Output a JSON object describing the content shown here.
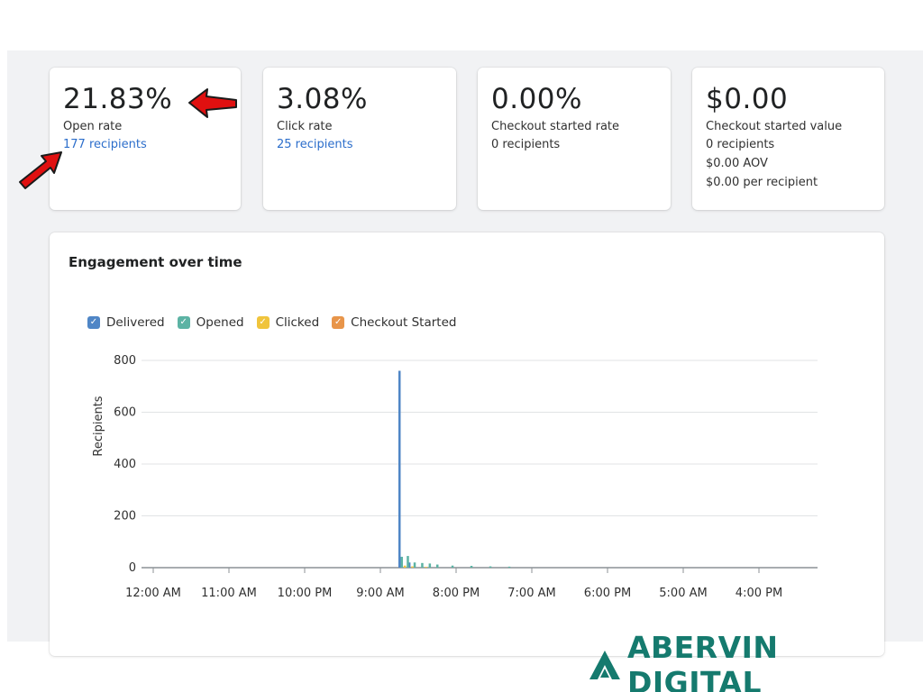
{
  "metrics": [
    {
      "value": "21.83%",
      "label": "Open rate",
      "lines": [
        "177 recipients"
      ]
    },
    {
      "value": "3.08%",
      "label": "Click rate",
      "lines": [
        "25 recipients"
      ]
    },
    {
      "value": "0.00%",
      "label": "Checkout started rate",
      "lines": [
        "0 recipients"
      ]
    },
    {
      "value": "$0.00",
      "label": "Checkout started value",
      "lines": [
        "0 recipients",
        "$0.00 AOV",
        "$0.00 per recipient"
      ]
    }
  ],
  "engagement": {
    "title": "Engagement over time",
    "legend": [
      {
        "name": "Delivered",
        "color": "#4f86c6",
        "checked": true
      },
      {
        "name": "Opened",
        "color": "#5cb3a4",
        "checked": true
      },
      {
        "name": "Clicked",
        "color": "#f0c43c",
        "checked": true
      },
      {
        "name": "Checkout Started",
        "color": "#e8954a",
        "checked": true
      }
    ]
  },
  "chart_data": {
    "type": "bar",
    "ylabel": "Recipients",
    "ylim": [
      0,
      800
    ],
    "yticks": [
      0,
      200,
      400,
      600,
      800
    ],
    "xticks": [
      "12:00 AM",
      "11:00 AM",
      "10:00 PM",
      "9:00 AM",
      "8:00 PM",
      "7:00 AM",
      "6:00 PM",
      "5:00 AM",
      "4:00 PM"
    ],
    "grid": true,
    "series": [
      {
        "name": "Delivered",
        "color": "#4f86c6",
        "points": [
          {
            "x": 3.25,
            "y": 760
          },
          {
            "x": 3.38,
            "y": 20
          }
        ]
      },
      {
        "name": "Opened",
        "color": "#5cb3a4",
        "points": [
          {
            "x": 3.28,
            "y": 42
          },
          {
            "x": 3.36,
            "y": 45
          },
          {
            "x": 3.45,
            "y": 20
          },
          {
            "x": 3.55,
            "y": 18
          },
          {
            "x": 3.65,
            "y": 16
          },
          {
            "x": 3.75,
            "y": 12
          },
          {
            "x": 3.95,
            "y": 8
          },
          {
            "x": 4.2,
            "y": 7
          },
          {
            "x": 4.45,
            "y": 5
          },
          {
            "x": 4.7,
            "y": 4
          }
        ]
      },
      {
        "name": "Clicked",
        "color": "#f0c43c",
        "points": [
          {
            "x": 3.32,
            "y": 8
          },
          {
            "x": 3.42,
            "y": 5
          },
          {
            "x": 3.6,
            "y": 3
          }
        ]
      },
      {
        "name": "Checkout Started",
        "color": "#e8954a",
        "points": []
      }
    ]
  },
  "brand": {
    "name": "ABERVIN DIGITAL",
    "color": "#157a6e"
  }
}
